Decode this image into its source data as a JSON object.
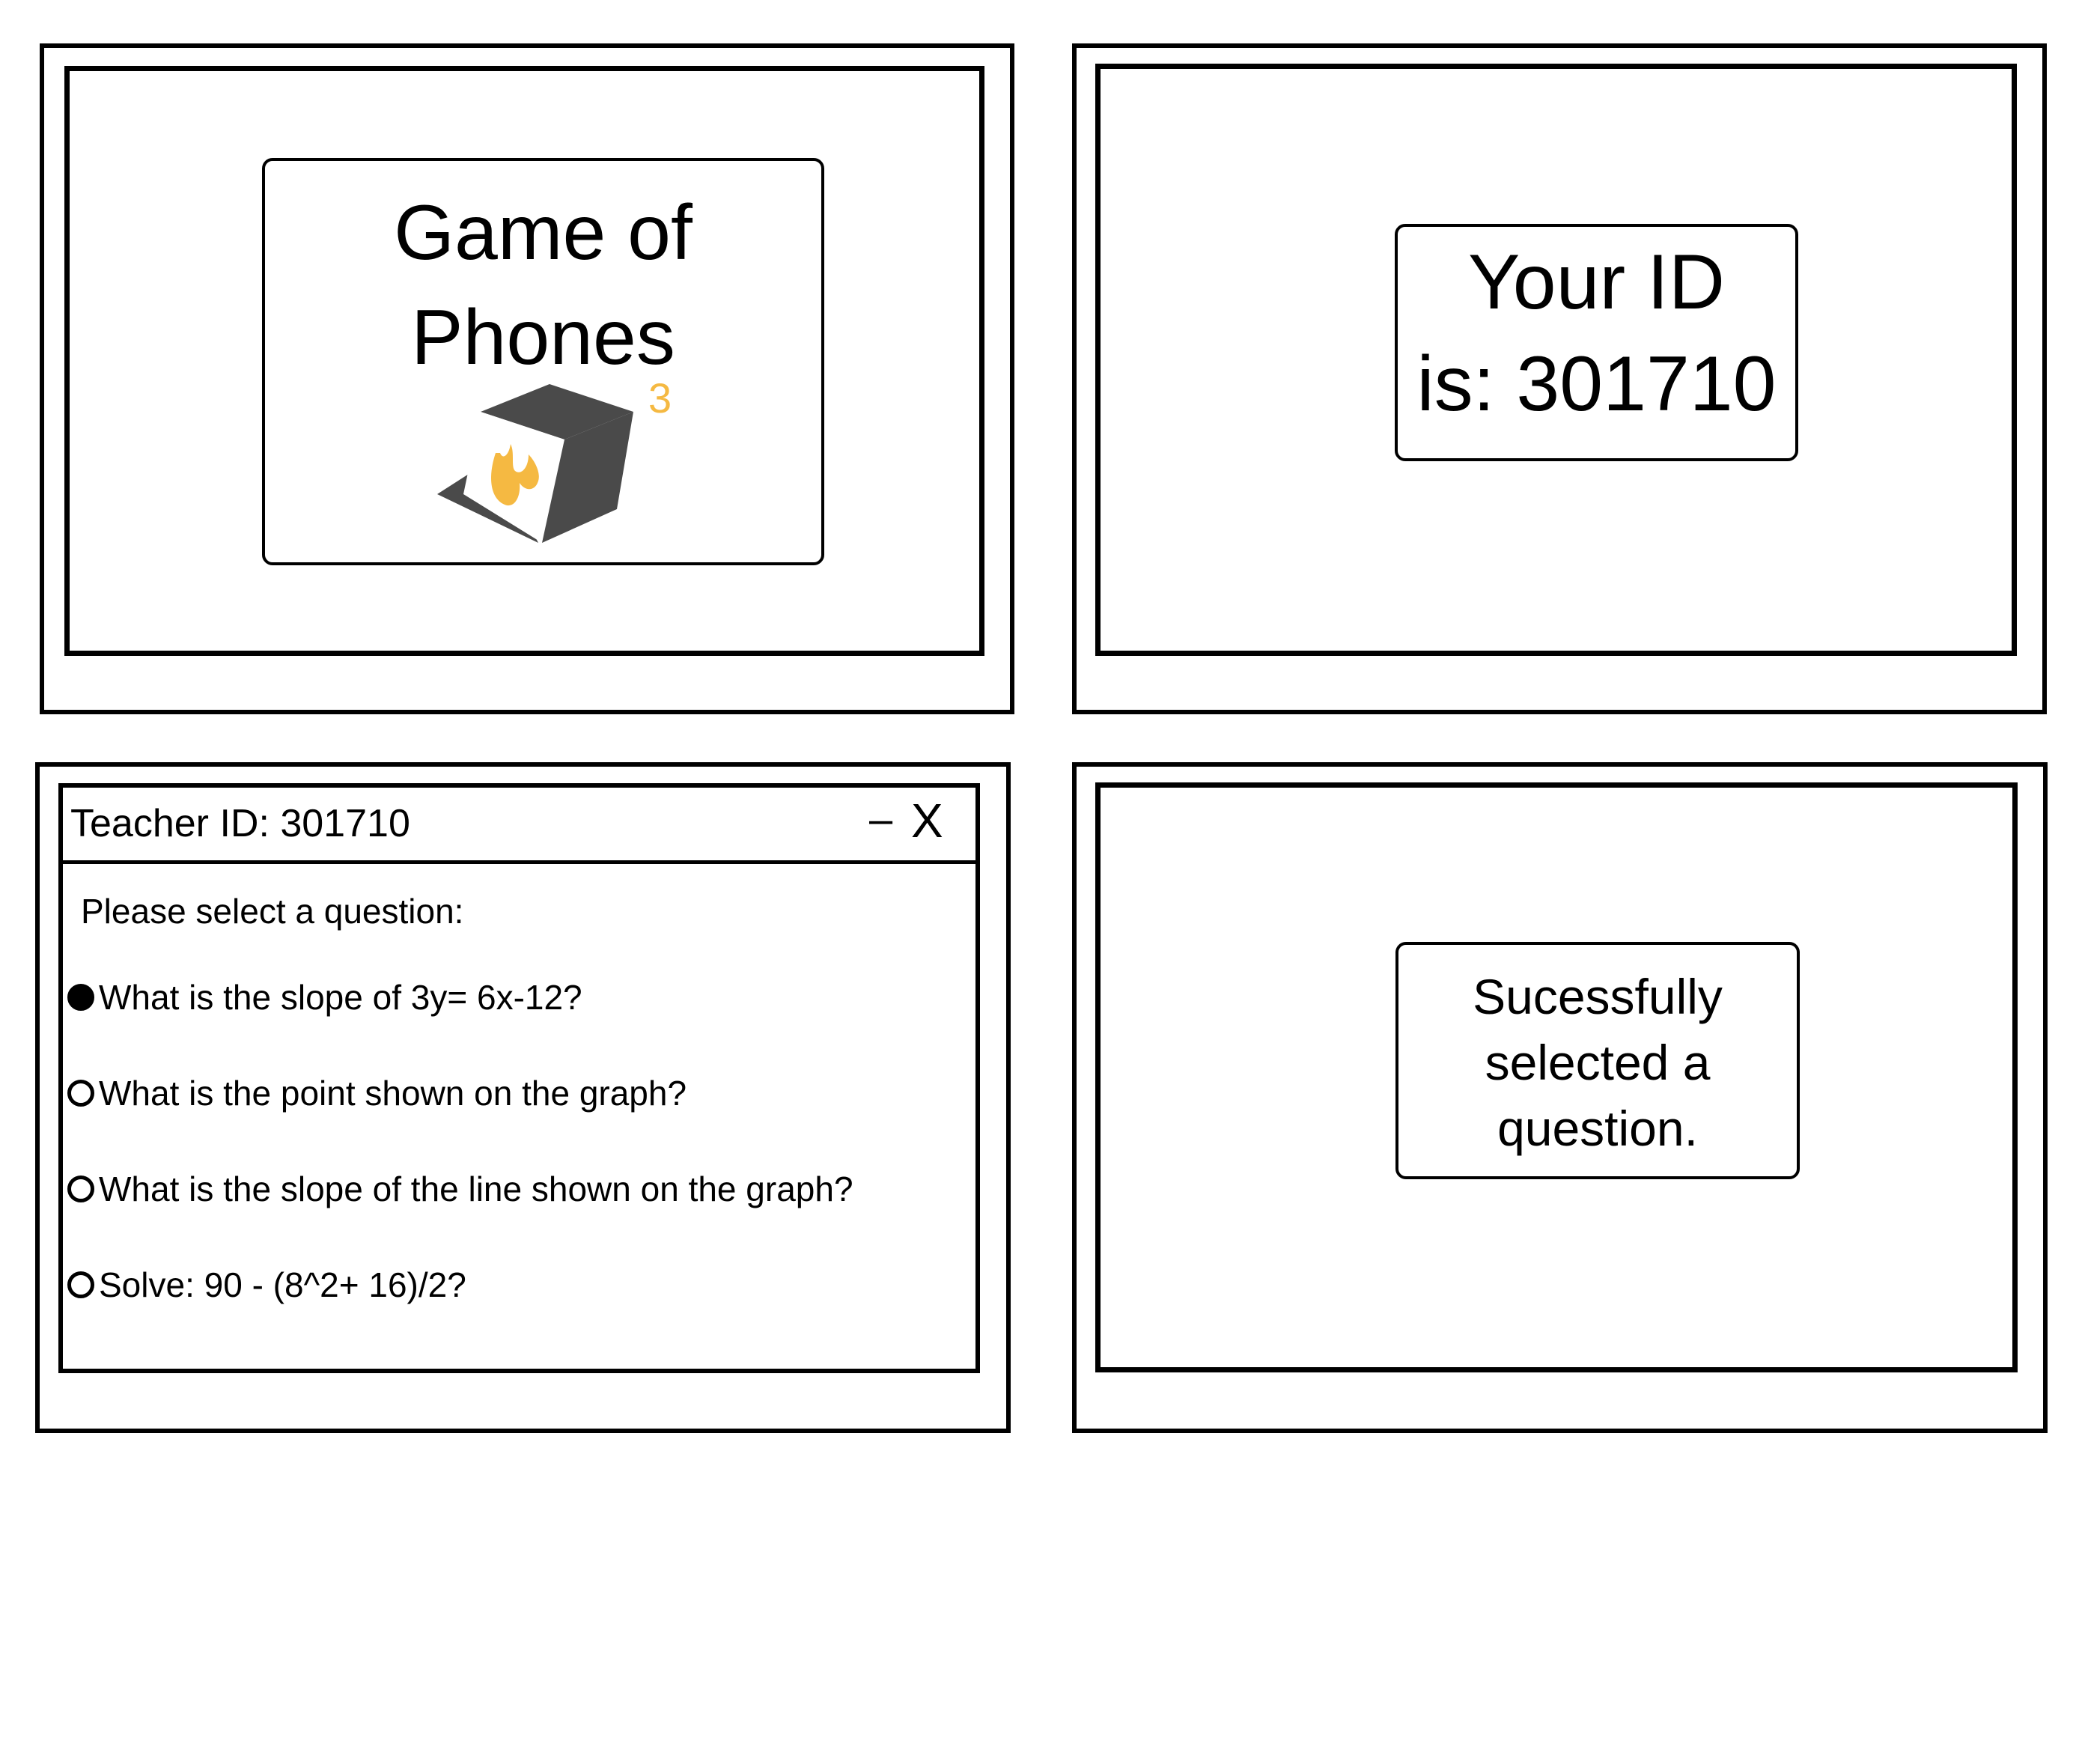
{
  "splash": {
    "title_line1": "Game of",
    "title_line2": "Phones",
    "logo_superscript": "3",
    "logo_icon": "cube-logo-icon",
    "logo_accent": "#f5b942",
    "logo_dark": "#4a4a4a"
  },
  "your_id": {
    "line1": "Your ID",
    "line2": "is: 301710"
  },
  "teacher_window": {
    "title": "Teacher ID: 301710",
    "minimize_label": "–",
    "close_label": "X",
    "prompt": "Please select a question:",
    "options": [
      {
        "label": "What is the slope of 3y= 6x-12?",
        "selected": true
      },
      {
        "label": "What is the point shown on the graph?",
        "selected": false
      },
      {
        "label": "What is the slope of the line shown on the graph?",
        "selected": false
      },
      {
        "label": "Solve: 90 - (8^2+ 16)/2?",
        "selected": false
      }
    ]
  },
  "success": {
    "line1": "Sucessfully",
    "line2": "selected a",
    "line3": "question."
  }
}
